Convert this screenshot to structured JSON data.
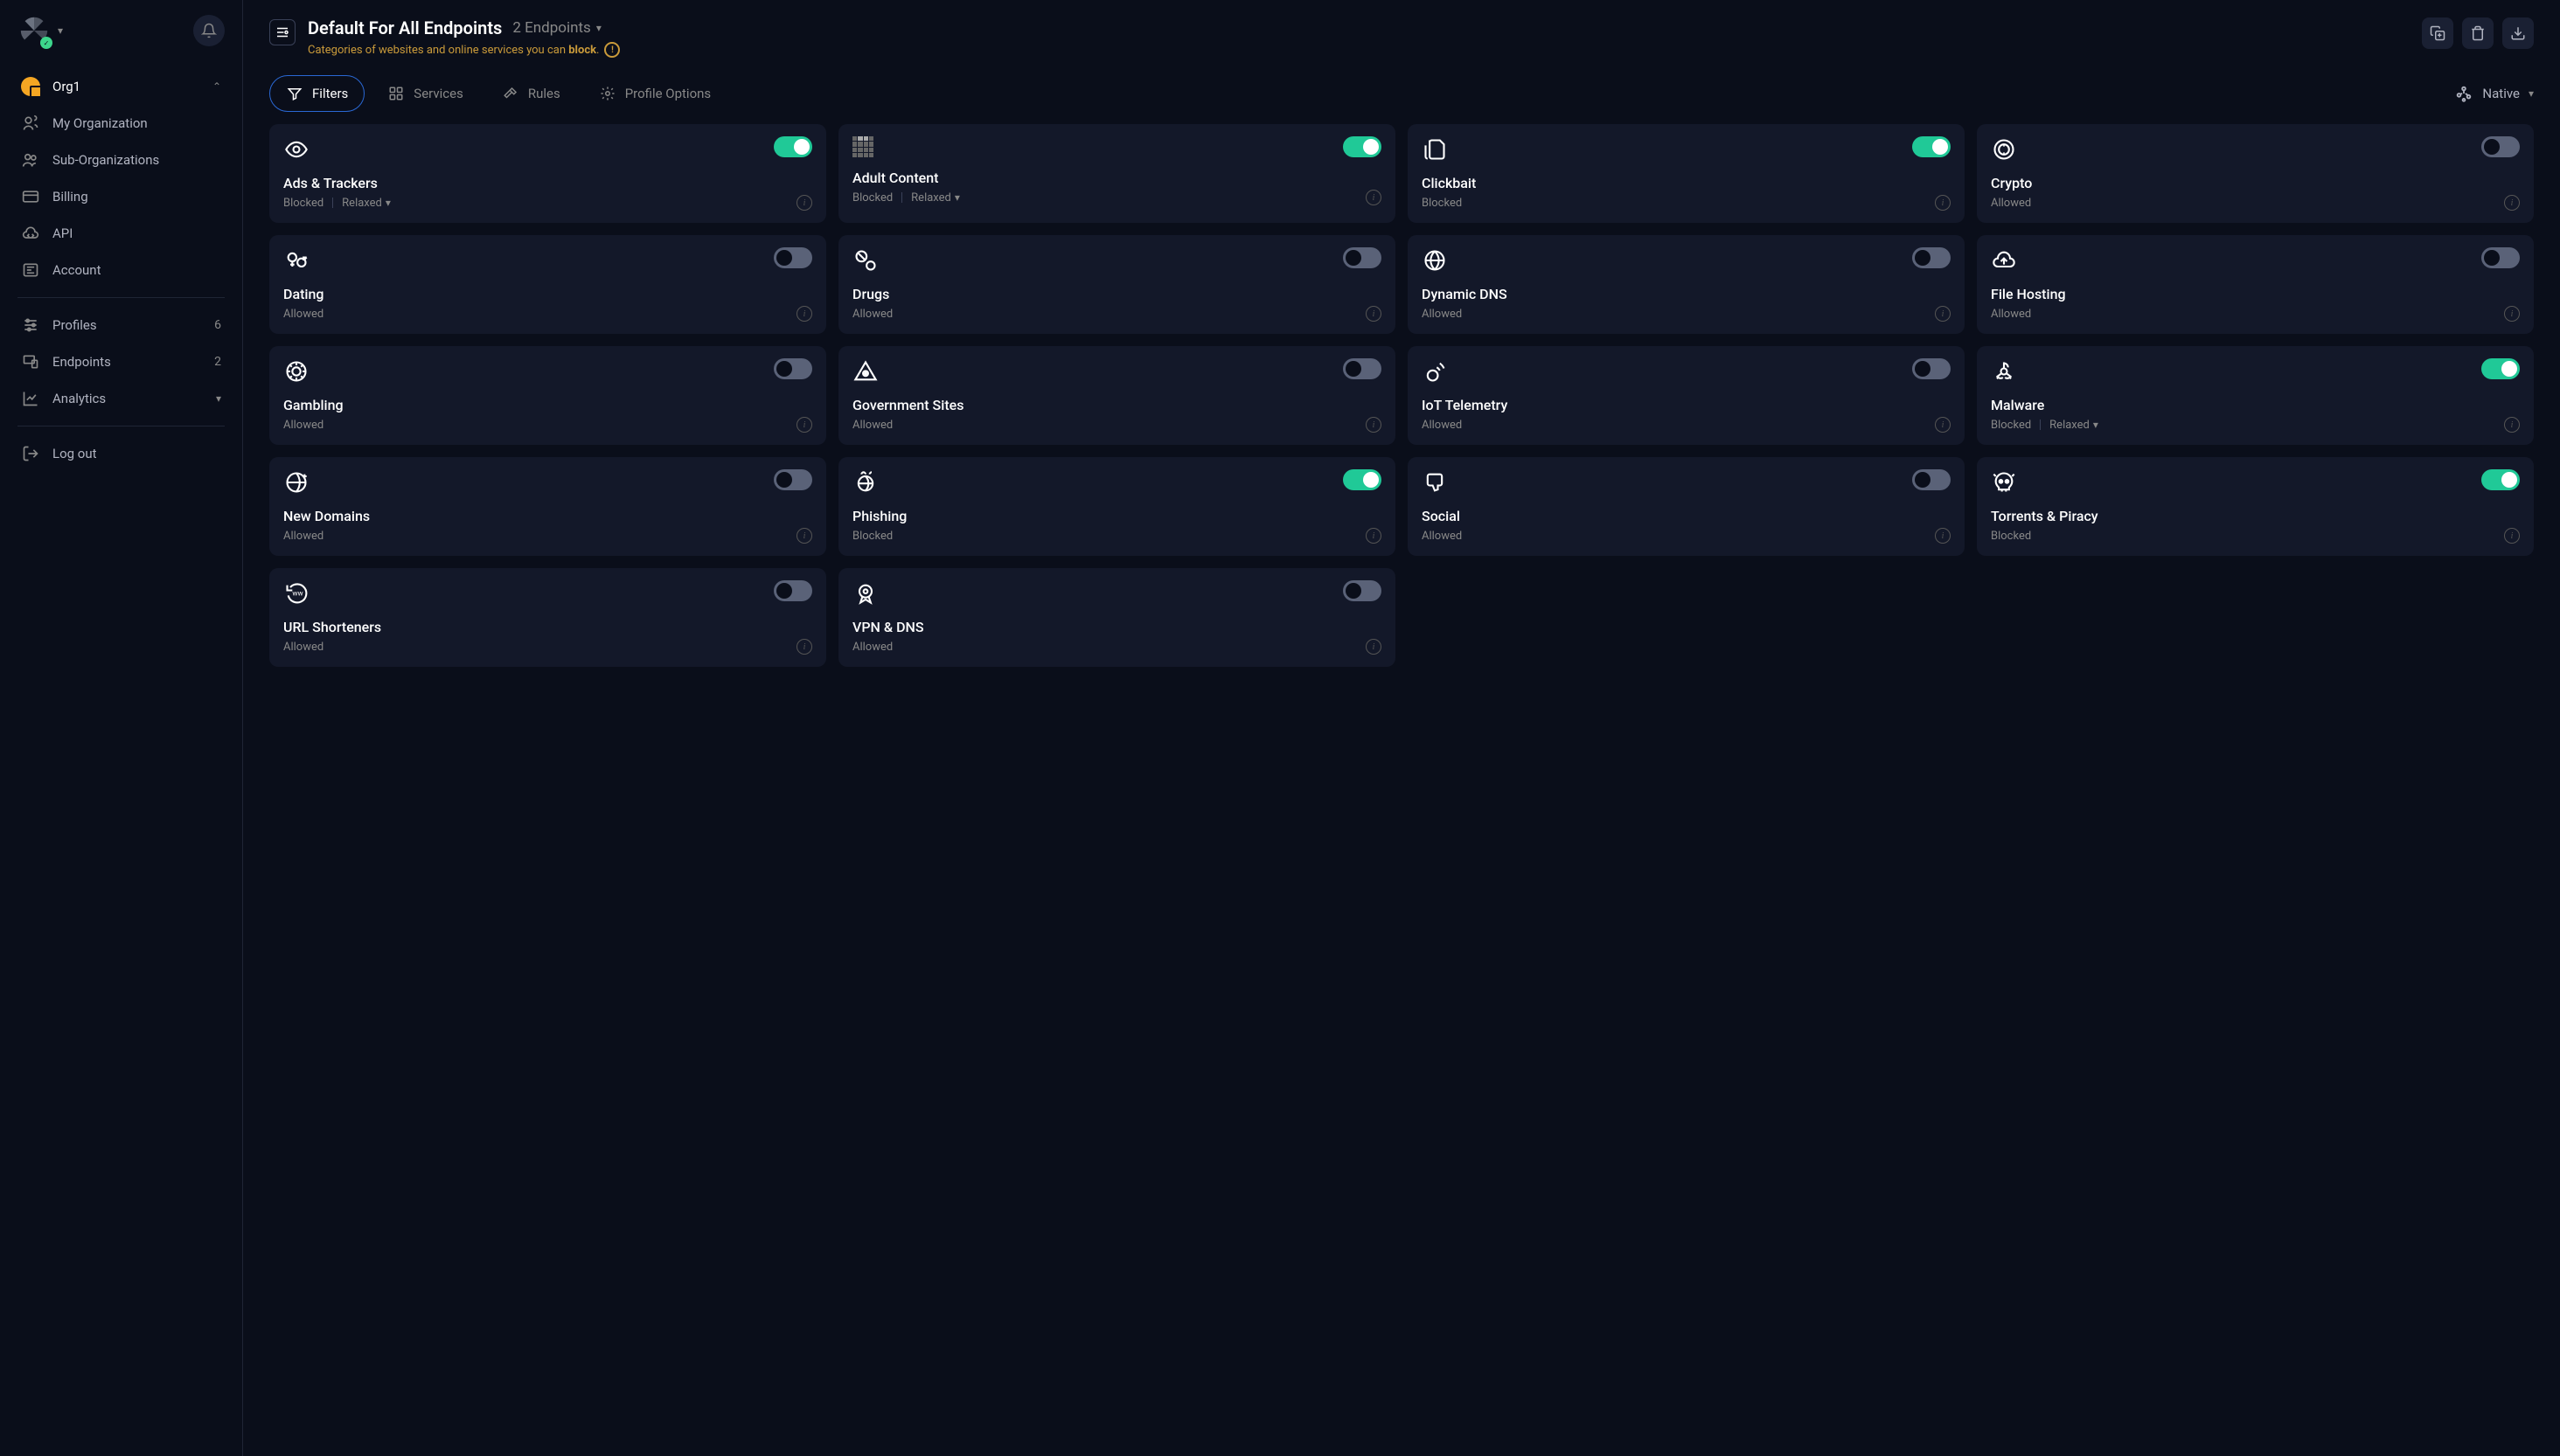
{
  "header": {
    "title": "Default For All Endpoints",
    "endpoints_label": "2 Endpoints",
    "description_prefix": "Categories of websites and online services you can ",
    "description_bold": "block",
    "description_suffix": "."
  },
  "sidebar": {
    "org_name": "Org1",
    "items_primary": [
      {
        "label": "My Organization",
        "icon": "users"
      },
      {
        "label": "Sub-Organizations",
        "icon": "users-plus"
      },
      {
        "label": "Billing",
        "icon": "card"
      },
      {
        "label": "API",
        "icon": "cloud-code"
      },
      {
        "label": "Account",
        "icon": "id"
      }
    ],
    "items_secondary": [
      {
        "label": "Profiles",
        "icon": "sliders",
        "count": "6"
      },
      {
        "label": "Endpoints",
        "icon": "device",
        "count": "2"
      },
      {
        "label": "Analytics",
        "icon": "chart",
        "expandable": true
      }
    ],
    "logout": "Log out"
  },
  "tabs": [
    {
      "label": "Filters",
      "icon": "filter",
      "active": true
    },
    {
      "label": "Services",
      "icon": "grid"
    },
    {
      "label": "Rules",
      "icon": "hammer"
    },
    {
      "label": "Profile Options",
      "icon": "gear"
    }
  ],
  "native_label": "Native",
  "filters": [
    {
      "name": "Ads & Trackers",
      "status": "Blocked",
      "mode": "Relaxed",
      "on": true,
      "icon": "eye"
    },
    {
      "name": "Adult Content",
      "status": "Blocked",
      "mode": "Relaxed",
      "on": true,
      "icon": "pixel"
    },
    {
      "name": "Clickbait",
      "status": "Blocked",
      "mode": null,
      "on": true,
      "icon": "paper"
    },
    {
      "name": "Crypto",
      "status": "Allowed",
      "mode": null,
      "on": false,
      "icon": "coin"
    },
    {
      "name": "Dating",
      "status": "Allowed",
      "mode": null,
      "on": false,
      "icon": "gender"
    },
    {
      "name": "Drugs",
      "status": "Allowed",
      "mode": null,
      "on": false,
      "icon": "pills"
    },
    {
      "name": "Dynamic DNS",
      "status": "Allowed",
      "mode": null,
      "on": false,
      "icon": "globe-grid"
    },
    {
      "name": "File Hosting",
      "status": "Allowed",
      "mode": null,
      "on": false,
      "icon": "cloud-up"
    },
    {
      "name": "Gambling",
      "status": "Allowed",
      "mode": null,
      "on": false,
      "icon": "chip"
    },
    {
      "name": "Government Sites",
      "status": "Allowed",
      "mode": null,
      "on": false,
      "icon": "pyramid-eye"
    },
    {
      "name": "IoT Telemetry",
      "status": "Allowed",
      "mode": null,
      "on": false,
      "icon": "signal"
    },
    {
      "name": "Malware",
      "status": "Blocked",
      "mode": "Relaxed",
      "on": true,
      "icon": "hazard"
    },
    {
      "name": "New Domains",
      "status": "Allowed",
      "mode": null,
      "on": false,
      "icon": "globe-plus"
    },
    {
      "name": "Phishing",
      "status": "Blocked",
      "mode": null,
      "on": true,
      "icon": "hook-globe"
    },
    {
      "name": "Social",
      "status": "Allowed",
      "mode": null,
      "on": false,
      "icon": "thumb-down"
    },
    {
      "name": "Torrents & Piracy",
      "status": "Blocked",
      "mode": null,
      "on": true,
      "icon": "skull"
    },
    {
      "name": "URL Shorteners",
      "status": "Allowed",
      "mode": null,
      "on": false,
      "icon": "ww-circle"
    },
    {
      "name": "VPN & DNS",
      "status": "Allowed",
      "mode": null,
      "on": false,
      "icon": "badge"
    }
  ]
}
